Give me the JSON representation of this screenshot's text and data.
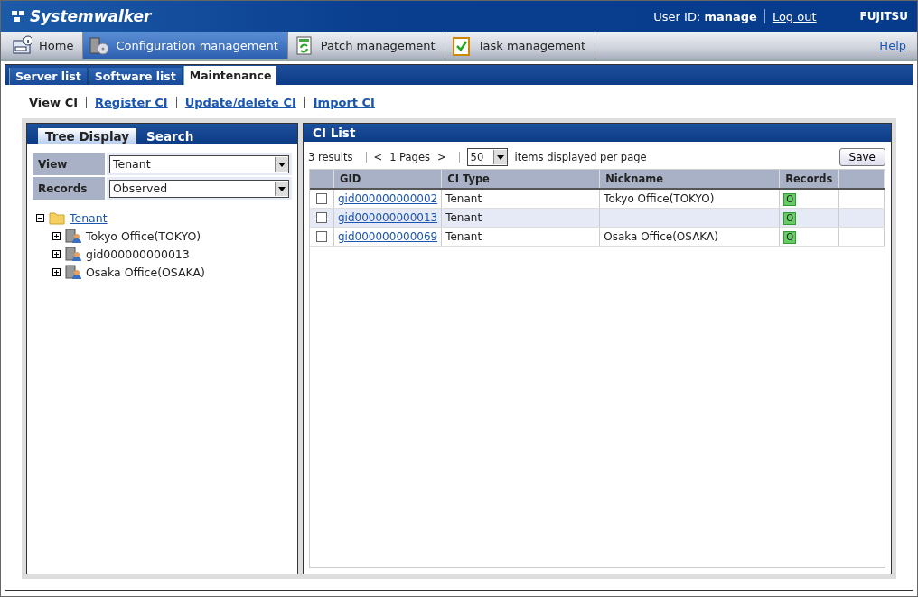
{
  "header": {
    "logo": "Systemwalker",
    "user_label": "User ID:",
    "user_id": "manage",
    "logout": "Log out",
    "brand": "FUJITSU"
  },
  "nav": {
    "items": [
      {
        "label": "Home",
        "kind": "home",
        "selected": false
      },
      {
        "label": "Configuration management",
        "kind": "config",
        "selected": true
      },
      {
        "label": "Patch management",
        "kind": "patch",
        "selected": false
      },
      {
        "label": "Task management",
        "kind": "task",
        "selected": false
      }
    ],
    "help": "Help"
  },
  "tabs": [
    {
      "label": "Server list",
      "selected": false
    },
    {
      "label": "Software list",
      "selected": false
    },
    {
      "label": "Maintenance",
      "selected": true
    }
  ],
  "subnav": [
    {
      "label": "View CI",
      "selected": true
    },
    {
      "label": "Register CI",
      "selected": false
    },
    {
      "label": "Update/delete CI",
      "selected": false
    },
    {
      "label": "Import CI",
      "selected": false
    }
  ],
  "left_panel": {
    "tabs": [
      {
        "label": "Tree Display",
        "selected": true
      },
      {
        "label": "Search",
        "selected": false
      }
    ],
    "filters": [
      {
        "label": "View",
        "value": "Tenant"
      },
      {
        "label": "Records",
        "value": "Observed"
      }
    ],
    "tree": [
      {
        "label": "Tenant",
        "kind": "folder",
        "expanded": true,
        "children": [
          {
            "label": "Tokyo Office(TOKYO)",
            "kind": "tenant",
            "expanded": false
          },
          {
            "label": "gid000000000013",
            "kind": "tenant",
            "expanded": false
          },
          {
            "label": "Osaka Office(OSAKA)",
            "kind": "tenant",
            "expanded": false
          }
        ]
      }
    ]
  },
  "ci_list": {
    "title": "CI List",
    "results": "3 results",
    "prev": "<",
    "pages": "1 Pages",
    "next": ">",
    "per_page": "50",
    "per_page_label": "items displayed per page",
    "save": "Save",
    "columns": [
      "GID",
      "CI Type",
      "Nickname",
      "Records"
    ],
    "rows": [
      {
        "checked": false,
        "gid": "gid000000000002",
        "type": "Tenant",
        "nickname": "Tokyo Office(TOKYO)",
        "records": "O"
      },
      {
        "checked": false,
        "gid": "gid000000000013",
        "type": "Tenant",
        "nickname": "",
        "records": "O"
      },
      {
        "checked": false,
        "gid": "gid000000000069",
        "type": "Tenant",
        "nickname": "Osaka Office(OSAKA)",
        "records": "O"
      }
    ]
  }
}
